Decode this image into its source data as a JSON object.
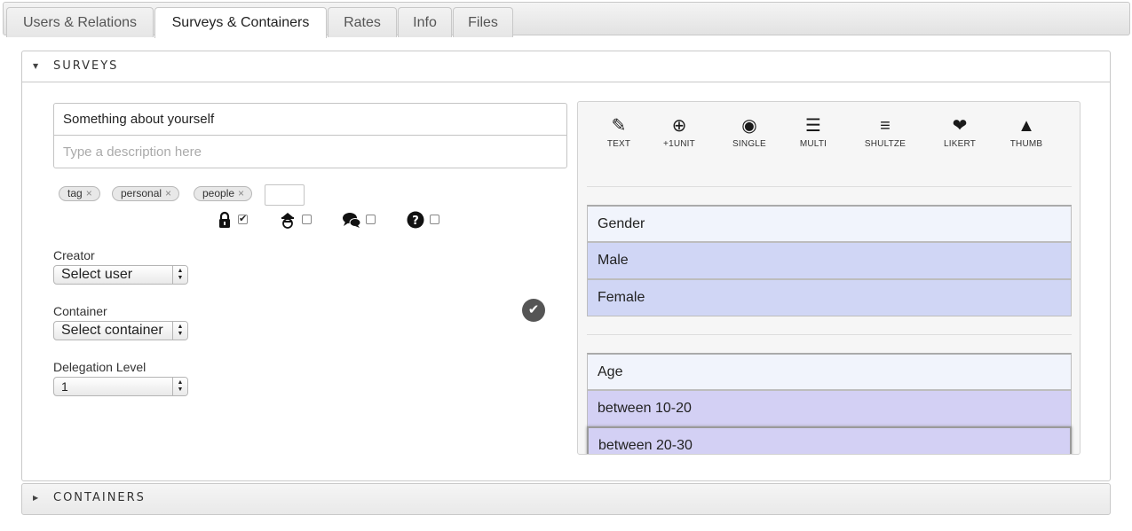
{
  "tabs": [
    {
      "label": "Users & Relations"
    },
    {
      "label": "Surveys & Containers"
    },
    {
      "label": "Rates"
    },
    {
      "label": "Info"
    },
    {
      "label": "Files"
    }
  ],
  "active_tab": "Surveys & Containers",
  "surveys_panel": {
    "title": "SURVEYS",
    "survey_title_value": "Something about yourself",
    "description_placeholder": "Type a description here",
    "tags": [
      "tag",
      "personal",
      "people"
    ],
    "flags": [
      {
        "icon": "lock-icon",
        "checked": true
      },
      {
        "icon": "spy-icon",
        "checked": false
      },
      {
        "icon": "chat-bubbles-icon",
        "checked": false
      },
      {
        "icon": "question-icon",
        "checked": false
      }
    ],
    "creator": {
      "label": "Creator",
      "value": "Select user"
    },
    "container": {
      "label": "Container",
      "value": "Select container"
    },
    "delegation": {
      "label": "Delegation Level",
      "value": "1"
    }
  },
  "toolbox": [
    {
      "label": "TEXT",
      "icon": "edit-icon"
    },
    {
      "label": "+1UNIT",
      "icon": "plus-circle-icon"
    },
    {
      "label": "SINGLE",
      "icon": "radio-icon"
    },
    {
      "label": "MULTI",
      "icon": "sliders-icon"
    },
    {
      "label": "SHULTZE",
      "icon": "ordered-list-icon"
    },
    {
      "label": "LIKERT",
      "icon": "heart-icon"
    },
    {
      "label": "THUMB",
      "icon": "thumbs-up-icon"
    }
  ],
  "questions": [
    {
      "title": "Gender",
      "options": [
        "Male",
        "Female"
      ]
    },
    {
      "title": "Age",
      "options": [
        "between 10-20",
        "between 20-30"
      ]
    }
  ],
  "containers_panel": {
    "title": "CONTAINERS"
  },
  "colors": {
    "option_blue": "#d0d6f5",
    "option_violet": "#d3d0f4",
    "question_head": "#f1f4fc"
  }
}
